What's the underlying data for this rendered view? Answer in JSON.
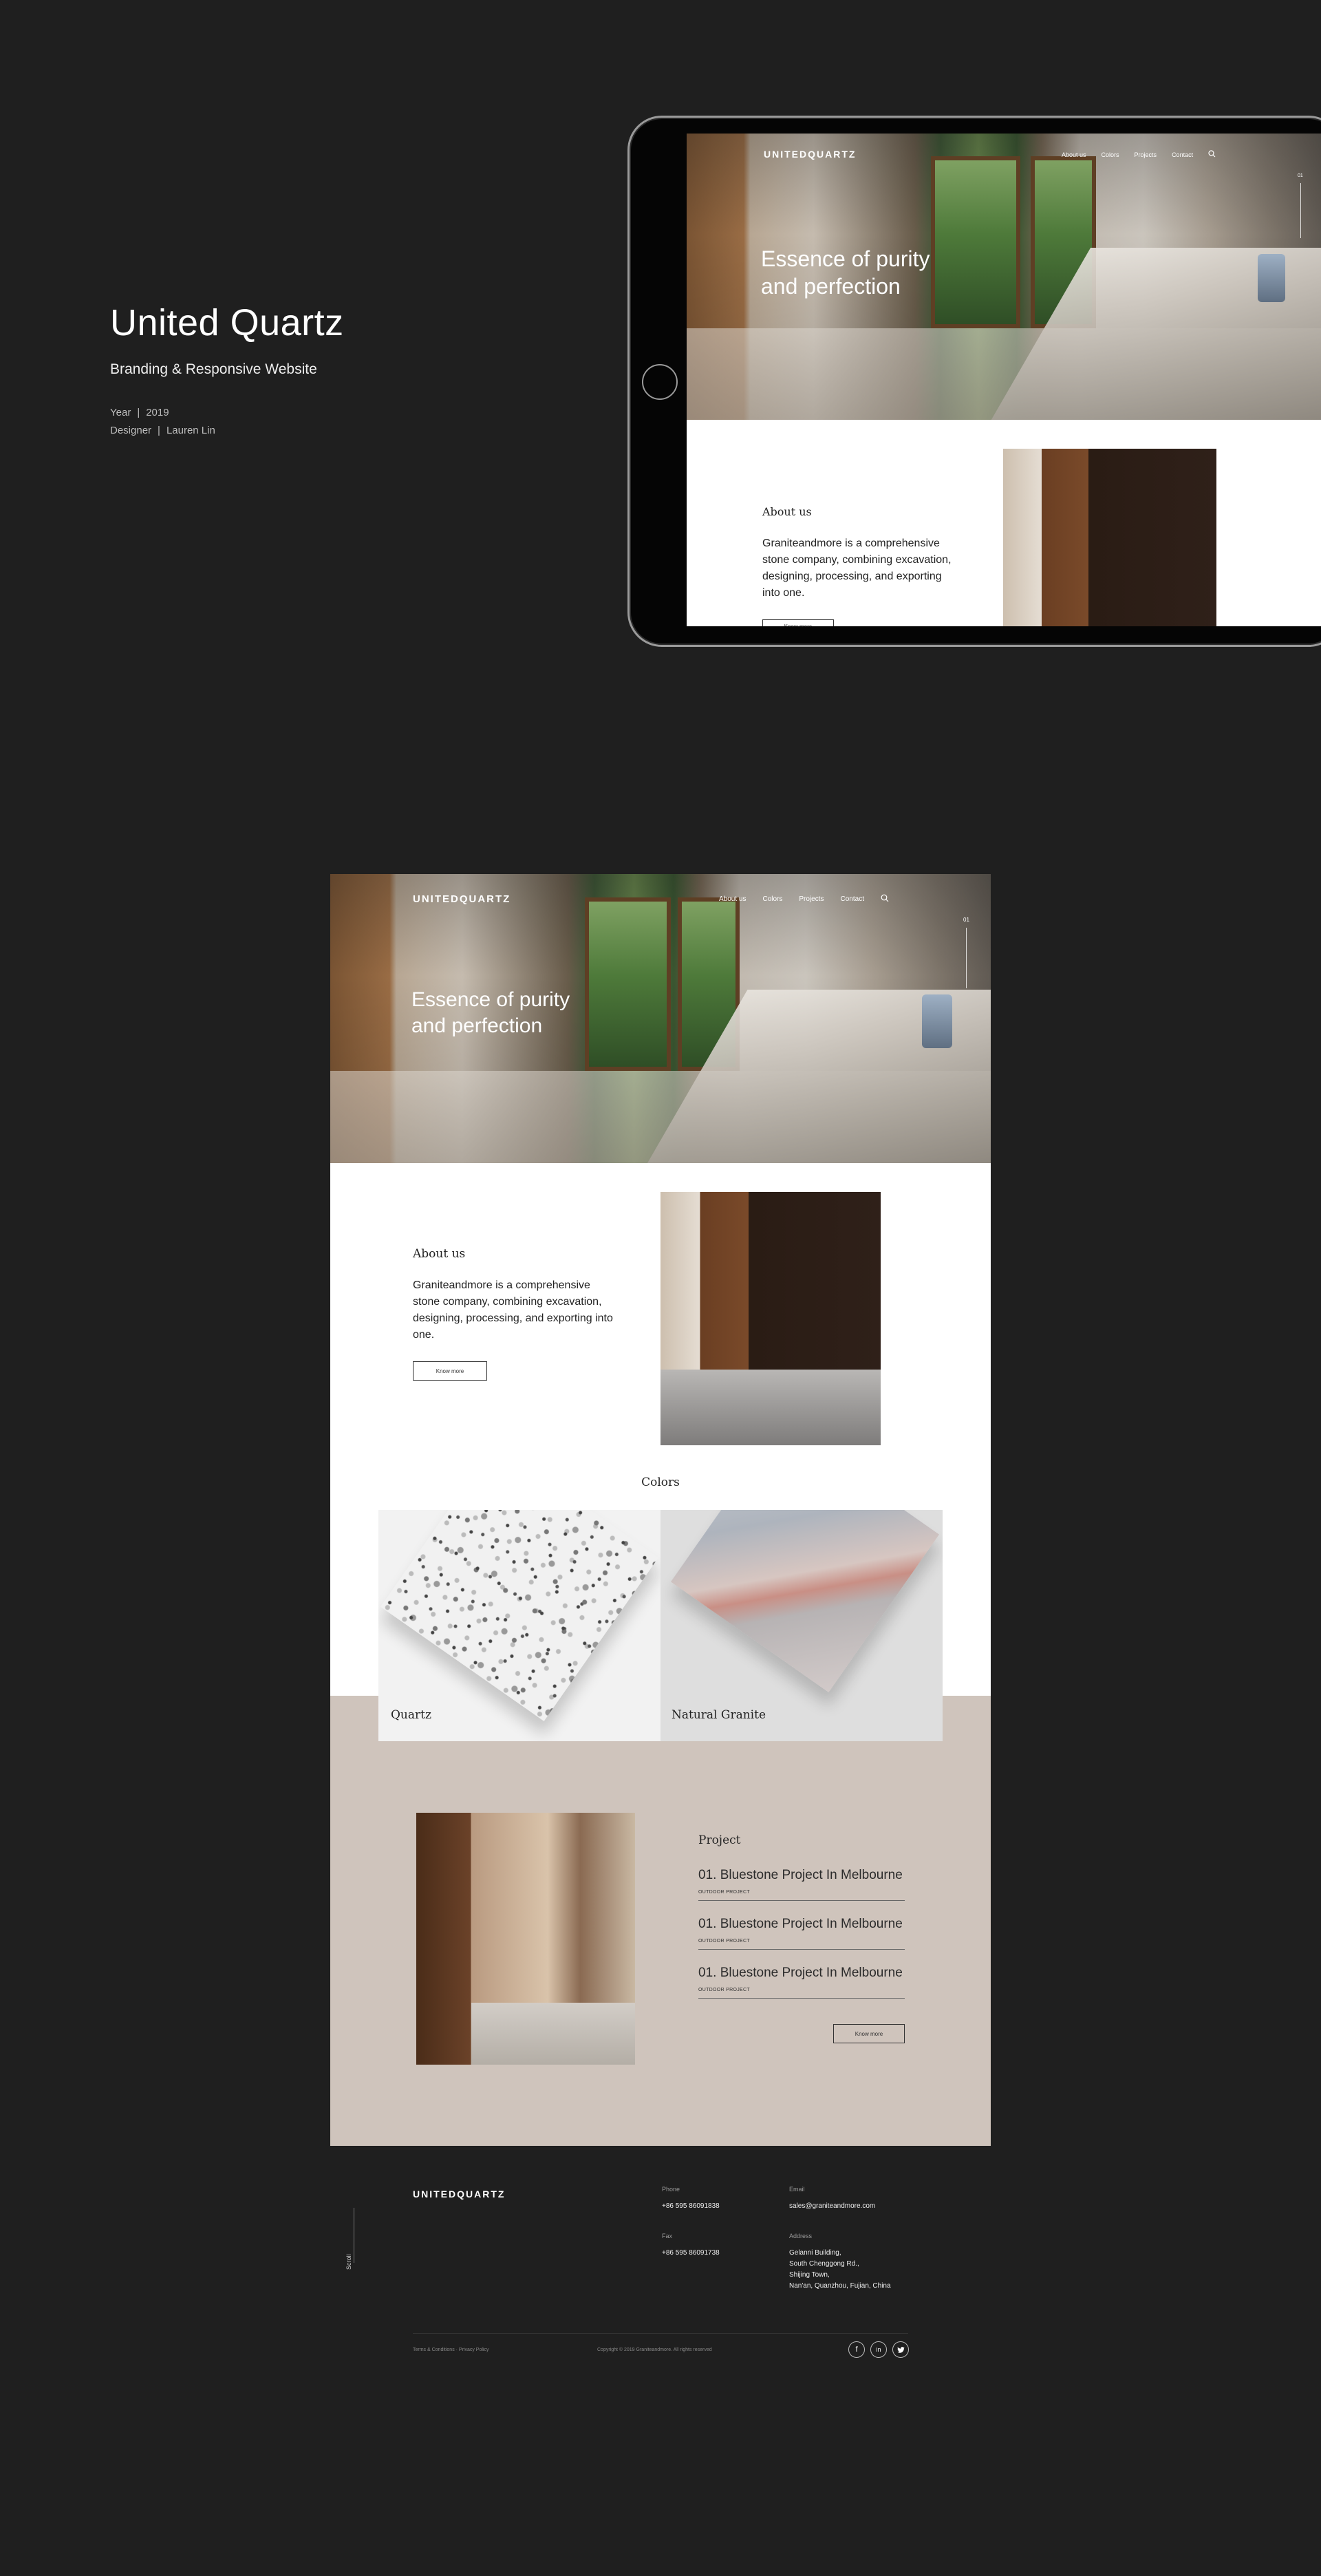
{
  "intro": {
    "title": "United Quartz",
    "subtitle": "Branding & Responsive Website",
    "year_label": "Year",
    "year_value": "2019",
    "designer_label": "Designer",
    "designer_value": "Lauren Lin",
    "separator": "|"
  },
  "brand": {
    "logo": "UNITEDQUARTZ"
  },
  "nav": {
    "items": [
      "About us",
      "Colors",
      "Projects",
      "Contact"
    ],
    "search_icon": "search-icon",
    "scroll_indicator": "01"
  },
  "hero": {
    "title_line1": "Essence of purity",
    "title_line2": "and perfection"
  },
  "about": {
    "heading": "About us",
    "body": "Graniteandmore is a comprehensive stone company, combining excavation, designing, processing, and exporting into one.",
    "button": "Know more"
  },
  "colors": {
    "heading": "Colors",
    "cards": [
      {
        "label": "Quartz"
      },
      {
        "label": "Natural Granite"
      }
    ]
  },
  "projects": {
    "heading": "Project",
    "items": [
      {
        "title": "01. Bluestone Project In Melbourne",
        "tag": "OUTDOOR PROJECT"
      },
      {
        "title": "01. Bluestone Project In Melbourne",
        "tag": "OUTDOOR PROJECT"
      },
      {
        "title": "01. Bluestone Project In Melbourne",
        "tag": "OUTDOOR PROJECT"
      }
    ],
    "button": "Know more"
  },
  "footer": {
    "logo": "UNITEDQUARTZ",
    "scroll_label": "Scroll",
    "phone_label": "Phone",
    "phone_value": "+86 595 86091838",
    "fax_label": "Fax",
    "fax_value": "+86 595 86091738",
    "email_label": "Email",
    "email_value": "sales@graniteandmore.com",
    "address_label": "Address",
    "address_lines": [
      "Gelanni Building,",
      "South Chenggong Rd.,",
      "Shijing Town,",
      "Nan'an, Quanzhou, Fujian, China"
    ],
    "terms": "Terms & Conditions · Privacy Policy",
    "copyright": "Copyright © 2019 Graniteandmore. All rights reserved",
    "social": [
      "f",
      "in",
      "t"
    ]
  },
  "colors_palette": {
    "page_bg": "#1f1f1f",
    "projects_bg": "#cfc4bc",
    "text_dark": "#222222"
  }
}
